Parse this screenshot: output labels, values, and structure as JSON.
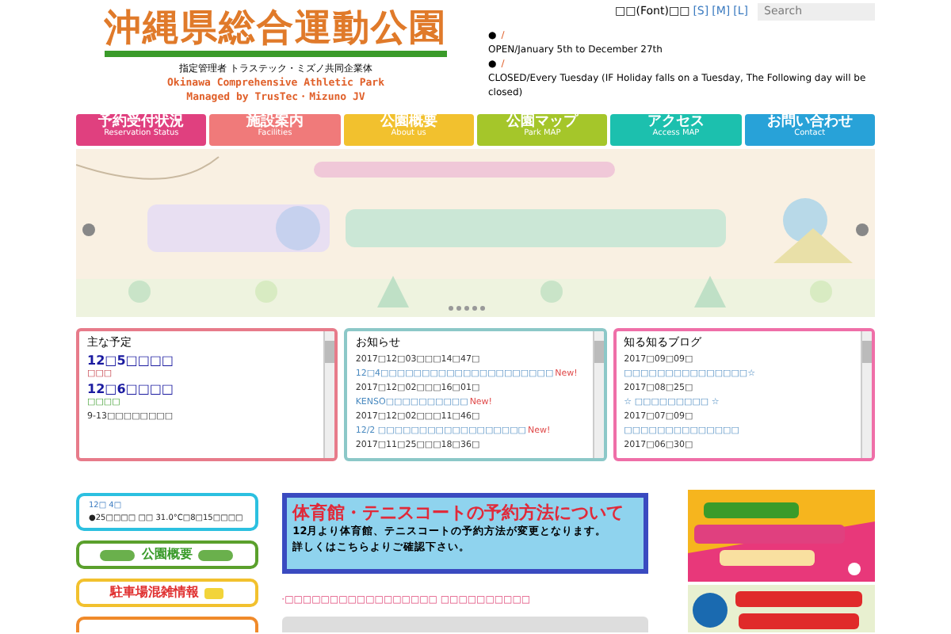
{
  "header": {
    "logo": "沖縄県総合運動公園",
    "operator": "指定管理者 トラステック・ミズノ共同企業体",
    "name_en": "Okinawa Comprehensive Athletic Park",
    "managed_by": "Managed by TrusTec・Mizuno JV",
    "font_size": {
      "label": "□□(Font)□□",
      "options": [
        {
          "label": "[S]",
          "selected": false
        },
        {
          "label": "[M]",
          "selected": false
        },
        {
          "label": "[L]",
          "selected": false
        }
      ]
    },
    "search": {
      "placeholder": "Search"
    },
    "info": [
      {
        "mark": "●",
        "text": "/"
      },
      {
        "text": "OPEN/January 5th to December 27th"
      },
      {
        "mark": "●",
        "text": "/"
      },
      {
        "text": "CLOSED/Every Tuesday (IF Holiday falls on a Tuesday, The Following day will be closed)"
      }
    ]
  },
  "nav": [
    {
      "label": "予約受付状況",
      "sub": "Reservation Status",
      "color": "#e0407f"
    },
    {
      "label": "施設案内",
      "sub": "Facilities",
      "color": "#f07a7a"
    },
    {
      "label": "公園概要",
      "sub": "About us",
      "color": "#f2c12e"
    },
    {
      "label": "公園マップ",
      "sub": "Park MAP",
      "color": "#a5c62a"
    },
    {
      "label": "アクセス",
      "sub": "Access MAP",
      "color": "#1cc0ae"
    },
    {
      "label": "お問い合わせ",
      "sub": "Contact",
      "color": "#28a2d8"
    }
  ],
  "slider": {
    "dots": [
      {
        "selected": false
      },
      {
        "selected": false
      },
      {
        "selected": false
      },
      {
        "selected": false
      },
      {
        "selected": false
      }
    ]
  },
  "panels": [
    {
      "title": "主な予定",
      "color": "#e77b8a",
      "items": [
        {
          "kind": "date",
          "text": "12□5□□□□"
        },
        {
          "kind": "red",
          "text": "□□□"
        },
        {
          "kind": "date",
          "text": "12□6□□□□"
        },
        {
          "kind": "green",
          "text": "□□□□"
        },
        {
          "kind": "plain",
          "text": "9-13□□□□□□□□"
        }
      ]
    },
    {
      "title": "お知らせ",
      "color": "#8cc8c8",
      "items": [
        {
          "kind": "plain",
          "text": "2017□12□03□□□14□47□"
        },
        {
          "kind": "link",
          "text": "12□4□□□□□□□□□□□□□□□□□□□□□",
          "new": "New!"
        },
        {
          "kind": "plain",
          "text": "2017□12□02□□□16□01□"
        },
        {
          "kind": "link",
          "text": "KENSO□□□□□□□□□□",
          "new": "New!"
        },
        {
          "kind": "plain",
          "text": "2017□12□02□□□11□46□"
        },
        {
          "kind": "link",
          "text": "12/2 □□□□□□□□□□□□□□□□□□",
          "new": "New!"
        },
        {
          "kind": "plain",
          "text": "2017□11□25□□□18□36□"
        }
      ]
    },
    {
      "title": "知る知るブログ",
      "color": "#ef6fa8",
      "items": [
        {
          "kind": "plain",
          "text": "2017□09□09□"
        },
        {
          "kind": "link",
          "text": "□□□□□□□□□□□□□□□☆"
        },
        {
          "kind": "plain",
          "text": "2017□08□25□"
        },
        {
          "kind": "link",
          "text": "☆ □□□□□□□□□ ☆"
        },
        {
          "kind": "plain",
          "text": "2017□07□09□"
        },
        {
          "kind": "link",
          "text": "□□□□□□□□□□□□□□"
        },
        {
          "kind": "plain",
          "text": "2017□06□30□"
        }
      ]
    }
  ],
  "weather": {
    "date": "12□ 4□",
    "text": "●25□□□□ □□ 31.0°C□8□15□□□□"
  },
  "side_buttons": [
    {
      "label": "公園概要",
      "kind": "trees",
      "color": "#5aa02c"
    },
    {
      "label": "駐車場混雑情報",
      "kind": "car",
      "color": "#f2c12e"
    }
  ],
  "notice": {
    "title": "体育館・テニスコートの予約方法について",
    "body": "12月より体育館、テニスコートの予約方法が変更となります。",
    "body2": "詳しくはこちらよりご確認下さい。"
  },
  "notice_link": "·□□□□□□□□□□□□□□□□□ □□□□□□□□□□"
}
